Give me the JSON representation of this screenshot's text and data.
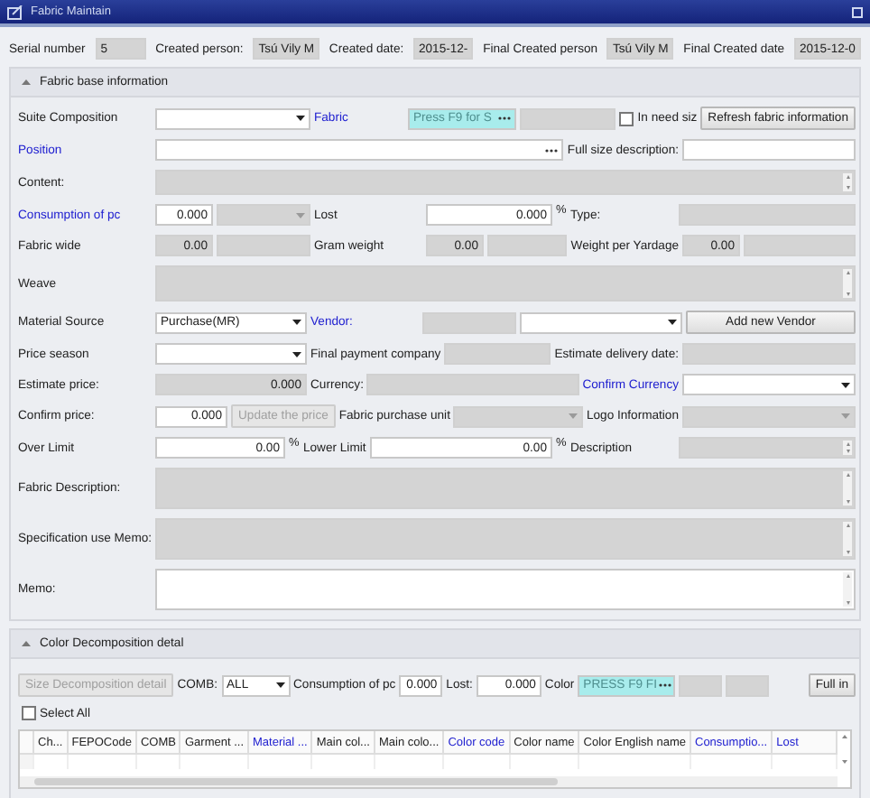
{
  "window": {
    "title": "Fabric Maintain"
  },
  "header": [
    {
      "label": "Serial number",
      "value": "5"
    },
    {
      "label": "Created person:",
      "value": "Tsú Vily M"
    },
    {
      "label": "Created date:",
      "value": "2015-12-"
    },
    {
      "label": "Final Created person",
      "value": "Tsú Vily M"
    },
    {
      "label": "Final Created date",
      "value": "2015-12-0"
    }
  ],
  "base_section": {
    "title": "Fabric base information",
    "expanded": true,
    "rows": [
      {
        "fields": [
          {
            "kind": "label",
            "text": "Suite Composition"
          },
          {
            "kind": "dropdown",
            "readonly": false
          },
          {
            "kind": "link",
            "text": "Fabric"
          },
          {
            "kind": "lookup",
            "highlighted": true,
            "placeholder": "Press F9 for S"
          },
          {
            "kind": "input",
            "readonly": true
          },
          {
            "kind": "checkbox",
            "text": "In need siz",
            "checked": false
          },
          {
            "kind": "button",
            "text": "Refresh fabric information",
            "disabled": false
          }
        ]
      },
      {
        "fields": [
          {
            "kind": "link",
            "text": "Position"
          },
          {
            "kind": "lookup",
            "highlighted": false
          },
          {
            "kind": "label",
            "text": "Full size description:"
          },
          {
            "kind": "input",
            "readonly": false
          }
        ]
      },
      {
        "fields": [
          {
            "kind": "label",
            "text": "Content:"
          },
          {
            "kind": "memo",
            "readonly": true
          }
        ]
      },
      {
        "fields": [
          {
            "kind": "link",
            "text": "Consumption of pc"
          },
          {
            "kind": "input",
            "readonly": false,
            "value": "0.000"
          },
          {
            "kind": "dropdown",
            "readonly": true
          },
          {
            "kind": "label",
            "text": "Lost"
          },
          {
            "kind": "input",
            "readonly": false,
            "value": "0.000"
          },
          {
            "kind": "unit",
            "text": "%"
          },
          {
            "kind": "label",
            "text": "Type:"
          },
          {
            "kind": "input",
            "readonly": true
          }
        ]
      },
      {
        "fields": [
          {
            "kind": "label",
            "text": "Fabric wide"
          },
          {
            "kind": "input",
            "readonly": true,
            "value": "0.00"
          },
          {
            "kind": "input",
            "readonly": true
          },
          {
            "kind": "label",
            "text": "Gram weight"
          },
          {
            "kind": "input",
            "readonly": true,
            "value": "0.00"
          },
          {
            "kind": "input",
            "readonly": true
          },
          {
            "kind": "label",
            "text": "Weight per Yardage"
          },
          {
            "kind": "input",
            "readonly": true,
            "value": "0.00"
          },
          {
            "kind": "input",
            "readonly": true
          }
        ]
      },
      {
        "fields": [
          {
            "kind": "label",
            "text": "Weave"
          },
          {
            "kind": "memo",
            "readonly": true
          }
        ]
      },
      {
        "fields": [
          {
            "kind": "label",
            "text": "Material Source"
          },
          {
            "kind": "dropdown",
            "readonly": false,
            "value": "Purchase(MR)"
          },
          {
            "kind": "link",
            "text": "Vendor:"
          },
          {
            "kind": "input",
            "readonly": true
          },
          {
            "kind": "dropdown",
            "readonly": false
          },
          {
            "kind": "button",
            "text": "Add new Vendor",
            "disabled": false
          }
        ]
      },
      {
        "fields": [
          {
            "kind": "label",
            "text": "Price season"
          },
          {
            "kind": "dropdown",
            "readonly": false
          },
          {
            "kind": "label",
            "text": "Final payment company"
          },
          {
            "kind": "input",
            "readonly": true
          },
          {
            "kind": "label",
            "text": "Estimate delivery date:"
          },
          {
            "kind": "input",
            "readonly": true
          }
        ]
      },
      {
        "fields": [
          {
            "kind": "label",
            "text": "Estimate price:"
          },
          {
            "kind": "input",
            "readonly": true,
            "value": "0.000"
          },
          {
            "kind": "label",
            "text": "Currency:"
          },
          {
            "kind": "input",
            "readonly": true
          },
          {
            "kind": "link",
            "text": "Confirm Currency"
          },
          {
            "kind": "dropdown",
            "readonly": false
          }
        ]
      },
      {
        "fields": [
          {
            "kind": "label",
            "text": "Confirm price:"
          },
          {
            "kind": "input",
            "readonly": false,
            "value": "0.000"
          },
          {
            "kind": "button",
            "text": "Update the price",
            "disabled": true
          },
          {
            "kind": "label",
            "text": "Fabric purchase unit"
          },
          {
            "kind": "dropdown",
            "readonly": true
          },
          {
            "kind": "label",
            "text": "Logo Information"
          },
          {
            "kind": "dropdown",
            "readonly": true
          }
        ]
      },
      {
        "fields": [
          {
            "kind": "label",
            "text": "Over Limit"
          },
          {
            "kind": "input",
            "readonly": false,
            "value": "0.00"
          },
          {
            "kind": "unit",
            "text": "%"
          },
          {
            "kind": "label",
            "text": "Lower Limit"
          },
          {
            "kind": "input",
            "readonly": false,
            "value": "0.00"
          },
          {
            "kind": "unit",
            "text": "%"
          },
          {
            "kind": "label",
            "text": "Description"
          },
          {
            "kind": "memo",
            "readonly": true
          }
        ]
      },
      {
        "fields": [
          {
            "kind": "label",
            "text": "Fabric Description:"
          },
          {
            "kind": "memo",
            "readonly": true
          }
        ]
      },
      {
        "fields": [
          {
            "kind": "label",
            "text": "Specification use Memo:"
          },
          {
            "kind": "memo",
            "readonly": true
          }
        ]
      },
      {
        "fields": [
          {
            "kind": "label",
            "text": "Memo:"
          },
          {
            "kind": "memo",
            "readonly": false
          }
        ]
      }
    ]
  },
  "color_section": {
    "title": "Color Decomposition detal",
    "expanded": true,
    "toolbar": [
      {
        "kind": "button",
        "text": "Size Decomposition detail",
        "disabled": true
      },
      {
        "kind": "label",
        "text": "COMB:"
      },
      {
        "kind": "dropdown",
        "readonly": false,
        "value": "ALL"
      },
      {
        "kind": "label",
        "text": "Consumption of pc"
      },
      {
        "kind": "input",
        "readonly": false,
        "value": "0.000"
      },
      {
        "kind": "label",
        "text": "Lost:"
      },
      {
        "kind": "input",
        "readonly": false,
        "value": "0.000"
      },
      {
        "kind": "label",
        "text": "Color"
      },
      {
        "kind": "lookup",
        "highlighted": true,
        "placeholder": "PRESS F9 FI"
      },
      {
        "kind": "input",
        "readonly": true
      },
      {
        "kind": "input",
        "readonly": true
      },
      {
        "kind": "button",
        "text": "Full in",
        "disabled": false
      }
    ],
    "select_all": {
      "text": "Select All",
      "checked": false
    },
    "table": {
      "columns": [
        {
          "text": "Ch...",
          "link": false
        },
        {
          "text": "FEPOCode",
          "link": false
        },
        {
          "text": "COMB",
          "link": false
        },
        {
          "text": "Garment ...",
          "link": false
        },
        {
          "text": "Material ...",
          "link": true
        },
        {
          "text": "Main col...",
          "link": false
        },
        {
          "text": "Main colo...",
          "link": false
        },
        {
          "text": "Color code",
          "link": true
        },
        {
          "text": "Color name",
          "link": false
        },
        {
          "text": "Color English name",
          "link": false
        },
        {
          "text": "Consumptio...",
          "link": true
        },
        {
          "text": "Lost",
          "link": true
        }
      ]
    }
  }
}
